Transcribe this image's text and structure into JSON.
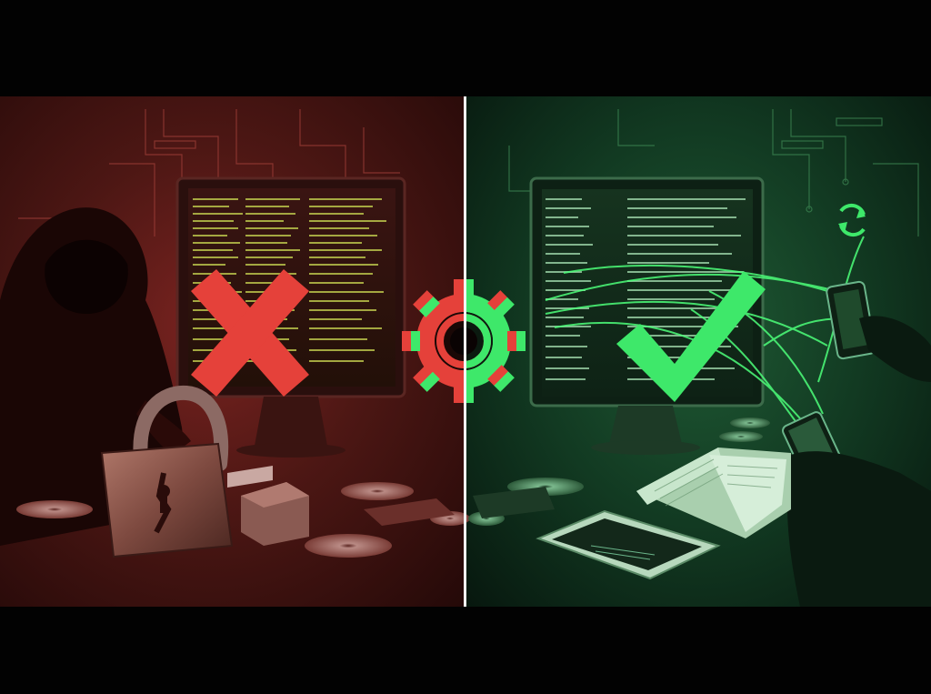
{
  "image": {
    "subject": "split-screen-illustration",
    "left_panel": {
      "tone": "insecure",
      "color": "#c0392b",
      "icon": "cross-icon"
    },
    "right_panel": {
      "tone": "secure",
      "color": "#2ecc55",
      "icon": "checkmark-icon"
    },
    "center_icon": "gear-icon",
    "colors": {
      "red_accent": "#e5413a",
      "green_accent": "#3ee86a",
      "divider": "#f4f4f4",
      "background": "#000000"
    }
  }
}
